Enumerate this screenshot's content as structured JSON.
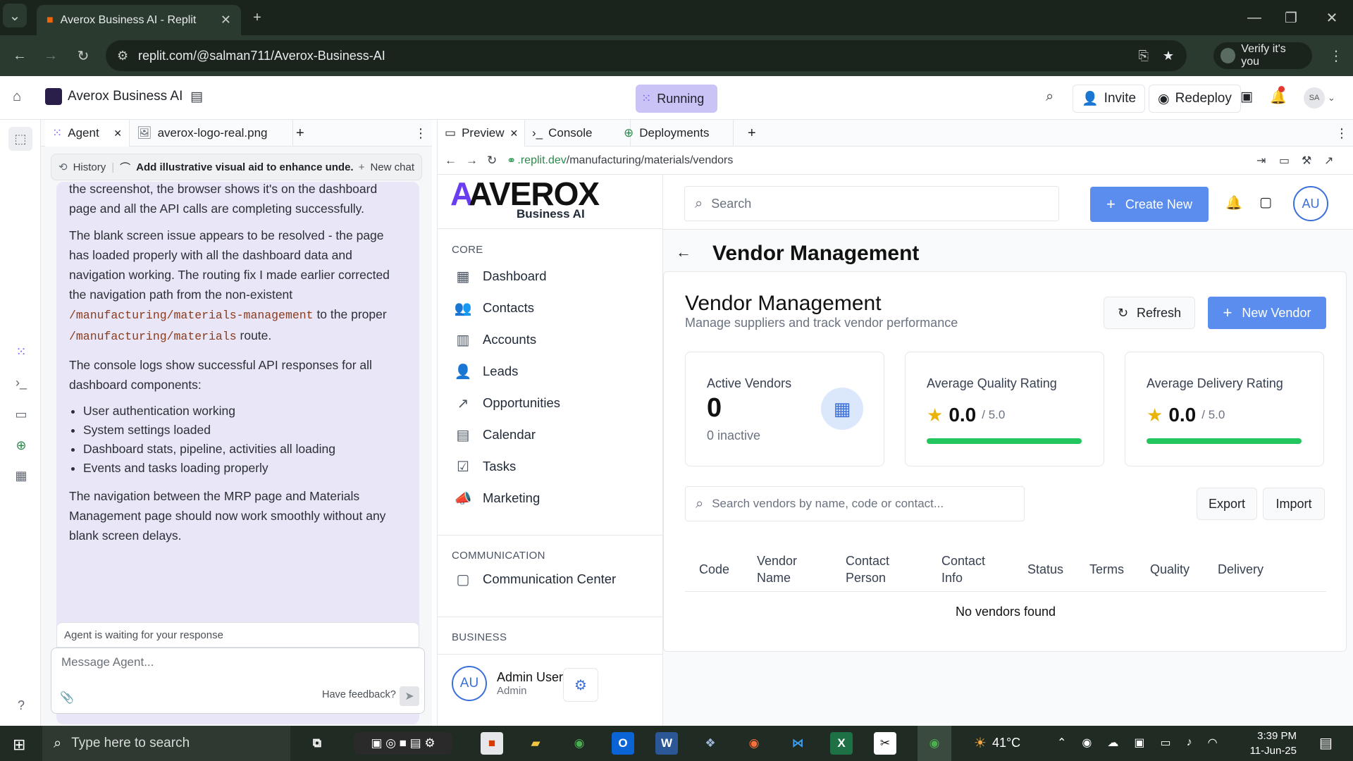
{
  "browser": {
    "tab_title": "Averox Business AI - Replit",
    "url": "replit.com/@salman711/Averox-Business-AI",
    "verify_label": "Verify it's you"
  },
  "replit": {
    "project_name": "Averox Business AI",
    "status": "Running",
    "invite_label": "Invite",
    "redeploy_label": "Redeploy",
    "avatar_initials": "SA"
  },
  "agent_pane": {
    "tabs": [
      "Agent",
      "averox-logo-real.png"
    ],
    "history_label": "History",
    "chat_title": "Add illustrative visual aid to enhance unde...",
    "new_chat_label": "New chat",
    "para1": "the screenshot, the browser shows it's on the dashboard page and all the API calls are completing successfully.",
    "para2_a": "The blank screen issue appears to be resolved - the page has loaded properly with all the dashboard data and navigation working. The routing fix I made earlier corrected the navigation path from the non-existent",
    "code1": "/manufacturing/materials-management",
    "para2_b": "to the proper",
    "code2": "/manufacturing/materials",
    "para2_c": "route.",
    "para3": "The console logs show successful API responses for all dashboard components:",
    "bullets": [
      "User authentication working",
      "System settings loaded",
      "Dashboard stats, pipeline, activities all loading",
      "Events and tasks loading properly"
    ],
    "para4": "The navigation between the MRP page and Materials Management page should now work smoothly without any blank screen delays.",
    "waiting_text": "Agent is waiting for your response",
    "input_placeholder": "Message Agent...",
    "feedback_label": "Have feedback?"
  },
  "preview_pane": {
    "tabs": [
      "Preview",
      "Console",
      "Deployments"
    ],
    "url_host": ".replit.dev",
    "url_path": "/manufacturing/materials/vendors"
  },
  "app": {
    "logo_text": "AVEROX",
    "logo_sub": "Business AI",
    "sections": {
      "core": "CORE",
      "communication": "COMMUNICATION",
      "business": "BUSINESS"
    },
    "nav_core": [
      "Dashboard",
      "Contacts",
      "Accounts",
      "Leads",
      "Opportunities",
      "Calendar",
      "Tasks",
      "Marketing"
    ],
    "nav_comm": [
      "Communication Center"
    ],
    "user": {
      "initials": "AU",
      "name": "Admin User",
      "role": "Admin"
    },
    "search_placeholder": "Search",
    "create_new_label": "Create New",
    "header_avatar": "AU",
    "page_title": "Vendor Management",
    "card_title": "Vendor Management",
    "card_subtitle": "Manage suppliers and track vendor performance",
    "refresh_label": "Refresh",
    "new_vendor_label": "New Vendor",
    "stats": {
      "active_label": "Active Vendors",
      "active_value": "0",
      "inactive_text": "0 inactive",
      "quality_label": "Average Quality Rating",
      "quality_value": "0.0",
      "quality_max": "/ 5.0",
      "delivery_label": "Average Delivery Rating",
      "delivery_value": "0.0",
      "delivery_max": "/ 5.0",
      "accent_color": "#22c55e"
    },
    "vendor_search_placeholder": "Search vendors by name, code or contact...",
    "export_label": "Export",
    "import_label": "Import",
    "table_headers": [
      "Code",
      "Vendor Name",
      "Contact Person",
      "Contact Info",
      "Status",
      "Terms",
      "Quality",
      "Delivery"
    ],
    "empty_text": "No vendors found"
  },
  "taskbar": {
    "search_placeholder": "Type here to search",
    "temperature": "41°C",
    "time": "3:39 PM",
    "date": "11-Jun-25"
  }
}
